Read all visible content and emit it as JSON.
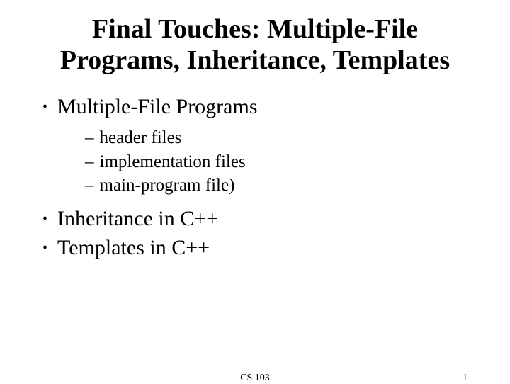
{
  "title": "Final Touches: Multiple-File Programs, Inheritance, Templates",
  "bullets": {
    "b1": "Multiple-File Programs",
    "sub": {
      "s1": "header files",
      "s2": "implementation files",
      "s3": "main-program file)"
    },
    "b2": "Inheritance in C++",
    "b3": "Templates in C++"
  },
  "footer": {
    "course": "CS 103",
    "page": "1"
  }
}
